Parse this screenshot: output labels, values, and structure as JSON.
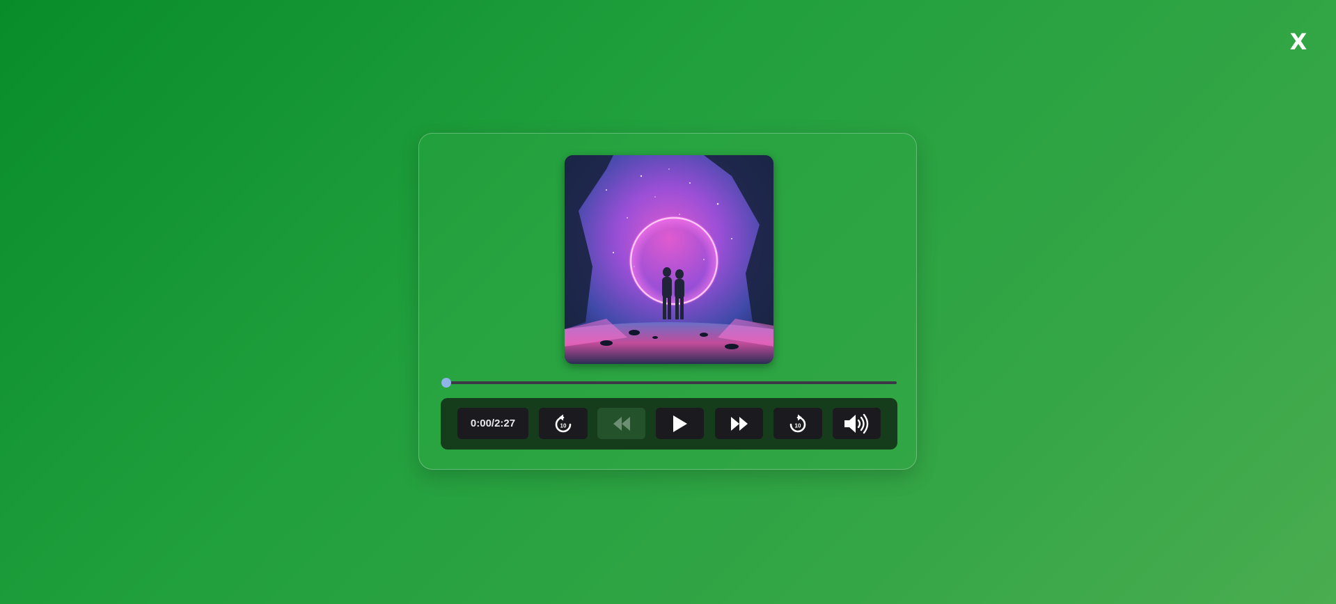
{
  "close": {
    "label": "X"
  },
  "player": {
    "time": "0:00/2:27",
    "progress": 0,
    "cover_alt": "Album cover: couple facing a glowing neon ring in a starry cave",
    "buttons": {
      "rewind_10_label": "10",
      "forward_10_label": "10"
    },
    "colors": {
      "background_start": "#088c2a",
      "background_end": "#4aad50",
      "controls_bg": "#153d1b",
      "button_bg": "#1b1a1f",
      "progress_thumb": "#8fb4ea"
    },
    "icons": [
      "rewind-10-icon",
      "skip-back-icon",
      "play-icon",
      "skip-forward-icon",
      "forward-10-icon",
      "volume-icon"
    ]
  }
}
